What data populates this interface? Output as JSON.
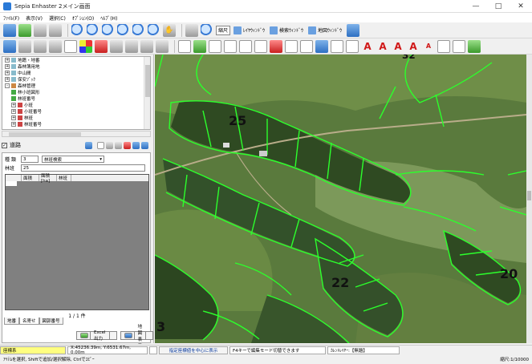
{
  "window": {
    "title": "Sepia Enhaster 2メイン画面"
  },
  "menu": [
    "ﾌｧｲﾙ(F)",
    "表示(V)",
    "選択(C)",
    "ｵﾌﾟｼｮﾝ(O)",
    "ﾍﾙﾌﾟ(H)"
  ],
  "toolbar1": {
    "scale_combo": "縮尺",
    "layer_window": "ﾚｲﾔｳｨﾝﾄﾞｳ",
    "search_window": "検索ｳｨﾝﾄﾞｳ",
    "map_window": "地図ｳｨﾝﾄﾞｳ"
  },
  "tree": {
    "items": [
      {
        "label": "地籍・地番",
        "expanded": false
      },
      {
        "label": "森林簿用地",
        "expanded": false
      },
      {
        "label": "中山間",
        "expanded": false
      },
      {
        "label": "保安ﾌﾞｯｸ",
        "expanded": false
      },
      {
        "label": "森林管理",
        "expanded": true
      },
      {
        "label": "林小班図形",
        "expanded": false,
        "indent": 1
      },
      {
        "label": "林班番号",
        "expanded": false,
        "indent": 1
      },
      {
        "label": "小班",
        "expanded": false,
        "indent": 1
      },
      {
        "label": "小班番号",
        "expanded": false,
        "indent": 1
      },
      {
        "label": "林班",
        "expanded": false,
        "indent": 1
      },
      {
        "label": "林班番号",
        "expanded": false,
        "indent": 1
      }
    ]
  },
  "panel": {
    "checkbox_label": "道路"
  },
  "search": {
    "type_label": "種 類",
    "type_value": "3",
    "type_combo": "林班検索",
    "id_label": "林班",
    "id_value": "25",
    "columns": [
      "",
      "面積",
      "面積[ha]",
      "林班"
    ],
    "pager": "1 / 1 件",
    "tabs": [
      "地番",
      "名寄せ",
      "図郭番号"
    ],
    "excel_button": "Excel出力",
    "map_button": "地図表示"
  },
  "map": {
    "labels": [
      {
        "text": "25"
      },
      {
        "text": "22"
      },
      {
        "text": "20"
      },
      {
        "text": "3"
      },
      {
        "text": "32"
      }
    ]
  },
  "status": {
    "layer": "座標系",
    "coords": "X:45236.39m, Y:6531.67m, 0.00m",
    "center_button": "指定座標値を中心に表示",
    "hint": "F4キーで編集モード切替できます",
    "mode": "ｶﾚﾝﾄﾚｲﾔｰ:【無題】",
    "help": "ｱｲﾃﾑを選択, Shiftで追加/選択解除, Ctrlでｺﾋﾟｰ",
    "scale": "縮尺:1/10000"
  }
}
